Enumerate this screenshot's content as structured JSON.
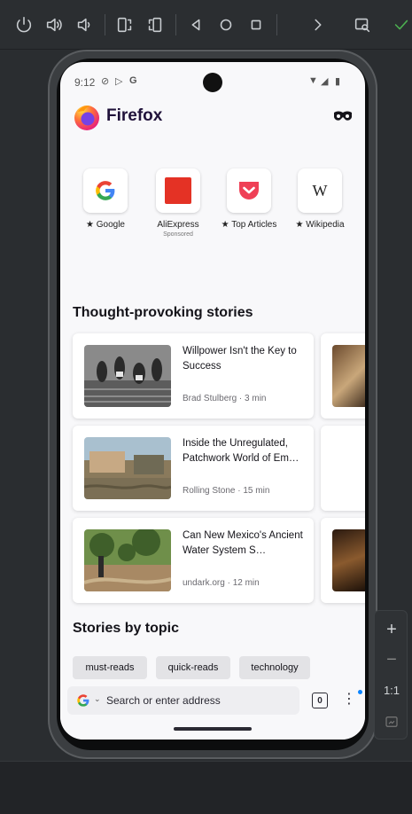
{
  "emulator": {
    "toolbar_icons": [
      "power-icon",
      "volume-up-icon",
      "volume-down-icon",
      "rotate-left-icon",
      "rotate-right-icon",
      "back-icon",
      "home-icon",
      "overview-icon",
      "more-icon",
      "screenshot-search-icon",
      "checkmark-icon"
    ],
    "side_panel": {
      "zoom_in": "+",
      "zoom_out": "−",
      "actual_size": "1:1"
    }
  },
  "status_bar": {
    "time": "9:12",
    "notification_icons": [
      "do-not-disturb-icon",
      "play-store-icon",
      "google-icon"
    ],
    "system_icons": [
      "wifi-icon",
      "signal-icon",
      "battery-icon"
    ]
  },
  "app": {
    "name": "Firefox"
  },
  "shortcuts": [
    {
      "label": "Google",
      "pinned": true,
      "sub": "",
      "icon": "google-g-icon"
    },
    {
      "label": "AliExpress",
      "pinned": false,
      "sub": "Sponsored",
      "icon": "aliexpress-icon"
    },
    {
      "label": "Top Articles",
      "pinned": true,
      "sub": "",
      "icon": "pocket-icon"
    },
    {
      "label": "Wikipedia",
      "pinned": true,
      "sub": "",
      "icon": "wikipedia-icon"
    }
  ],
  "pin_glyph": "★",
  "sections": {
    "stories": "Thought-provoking stories",
    "topics": "Stories by topic"
  },
  "stories": [
    {
      "headline": "Willpower Isn't the Key to Success",
      "meta": "Brad Stulberg · 3 min"
    },
    {
      "headline": "Inside the Unregulated, Patchwork World of Em…",
      "meta": "Rolling Stone · 15 min"
    },
    {
      "headline": "Can New Mexico's Ancient Water System S…",
      "meta": "undark.org · 12 min"
    }
  ],
  "topics": [
    "must-reads",
    "quick-reads",
    "technology"
  ],
  "address_bar": {
    "placeholder": "Search or enter address",
    "tab_count": "0",
    "caret": "⌄",
    "menu": "⋮"
  }
}
